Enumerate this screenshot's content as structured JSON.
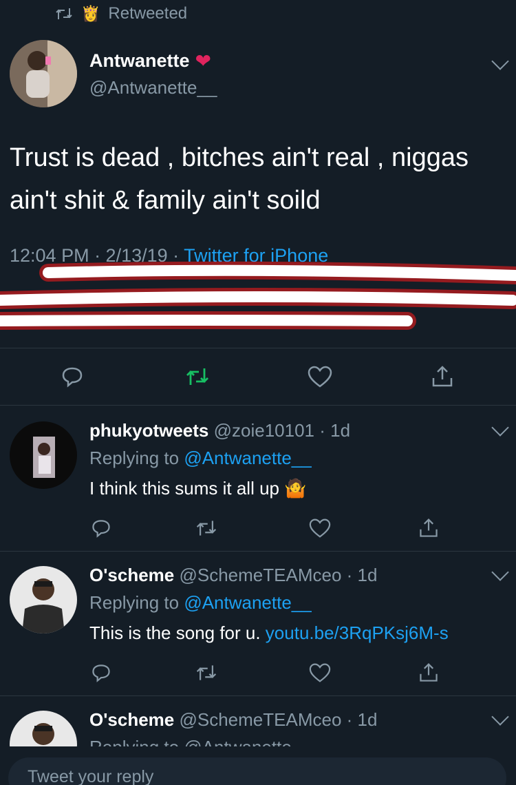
{
  "retweet": {
    "label": "Retweeted"
  },
  "main": {
    "name": "Antwanette",
    "handle": "@Antwanette__",
    "text_line1": "Trust is dead , bitches ain't real , niggas",
    "text_line2": "ain't shit & family ain't soild",
    "time": "12:04 PM · 2/13/19 · ",
    "source": "Twitter for iPhone"
  },
  "replies": [
    {
      "name": "phukyotweets",
      "handle": "@zoie10101",
      "age": " · 1d",
      "replying_label": "Replying to ",
      "replying_handle": "@Antwanette__",
      "text": "I think this sums it all up 🤷",
      "link": ""
    },
    {
      "name": "O'scheme",
      "handle": "@SchemeTEAMceo",
      "age": " · 1d",
      "replying_label": "Replying to ",
      "replying_handle": "@Antwanette__",
      "text": "This is the song for u. ",
      "link": "youtu.be/3RqPKsj6M-s"
    },
    {
      "name": "O'scheme",
      "handle": "@SchemeTEAMceo",
      "age": " · 1d",
      "replying_label": "Replying to @Antwanette",
      "replying_handle": "",
      "text": "",
      "link": ""
    }
  ],
  "compose": {
    "placeholder": "Tweet your reply"
  },
  "icons": {
    "reply": "reply-icon",
    "retweet": "retweet-icon",
    "like": "like-icon",
    "share": "share-icon",
    "chevron": "chevron-down-icon"
  },
  "colors": {
    "background": "#141d26",
    "muted": "#8899a6",
    "link": "#1da1f2",
    "retweet_active": "#17bf63",
    "scribble": "#ff1a1a"
  }
}
